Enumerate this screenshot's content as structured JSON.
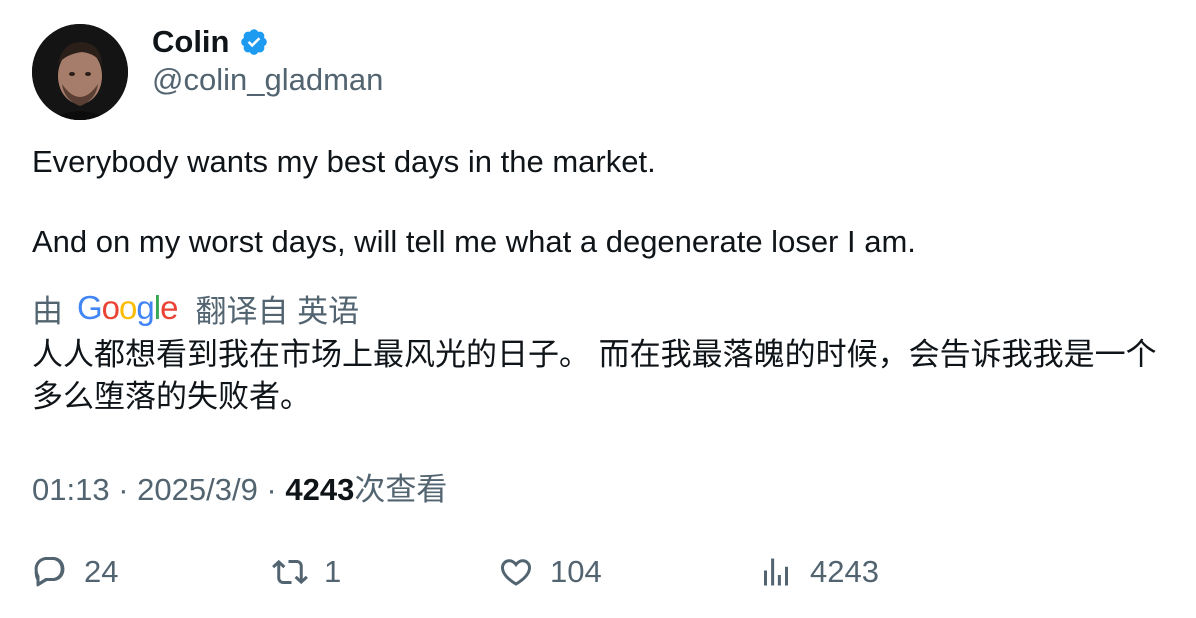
{
  "author": {
    "display_name": "Colin",
    "handle": "@colin_gladman",
    "verified_icon": "verified-badge-icon",
    "badge_color": "#1d9bf0"
  },
  "tweet": {
    "line1": "Everybody wants my best days in the market.",
    "line2": "And on my worst days, will tell me what a degenerate loser I am."
  },
  "translation": {
    "by_label": "由",
    "provider": "Google",
    "action_label": "翻译自 英语",
    "text": "人人都想看到我在市场上最风光的日子。 而在我最落魄的时候，会告诉我我是一个多么堕落的失败者。"
  },
  "meta": {
    "time": "01:13",
    "separator": " · ",
    "date": "2025/3/9",
    "views_count": "4243",
    "views_label": "次查看"
  },
  "actions": {
    "reply_count": "24",
    "retweet_count": "1",
    "like_count": "104",
    "views_count": "4243"
  },
  "colors": {
    "text": "#0f1419",
    "secondary": "#536471",
    "accent": "#1d9bf0"
  }
}
